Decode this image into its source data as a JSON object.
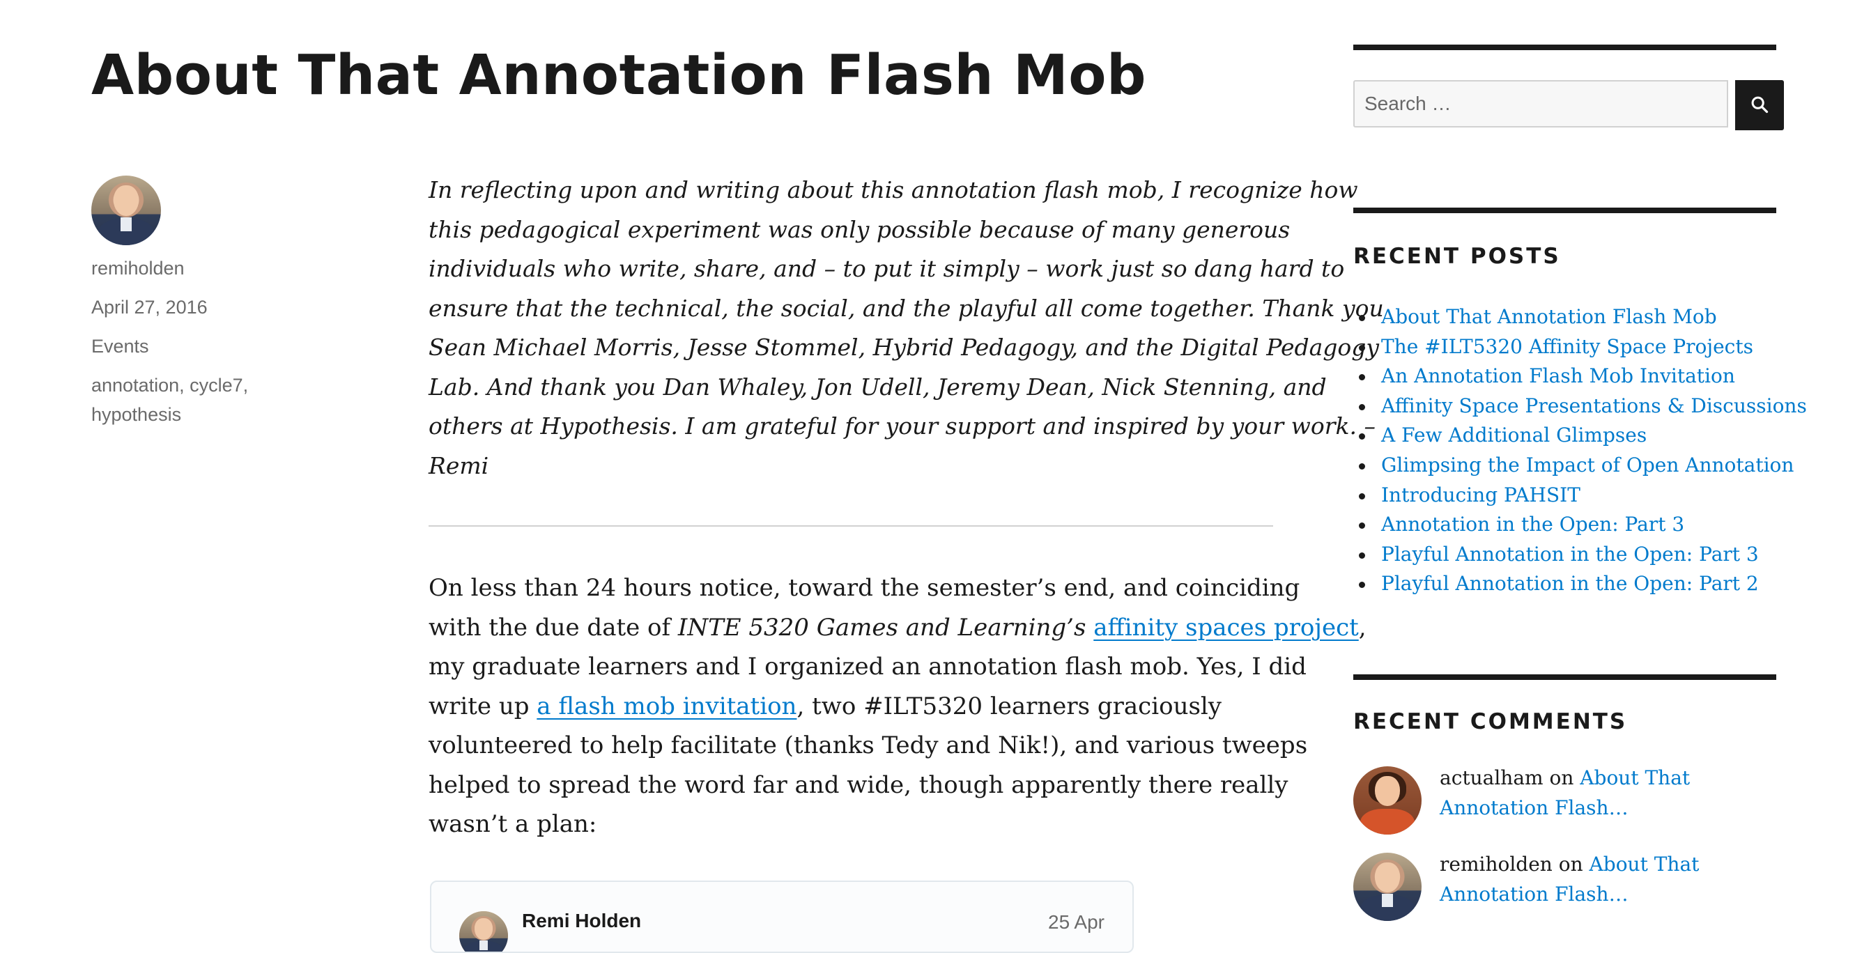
{
  "post": {
    "title": "About That Annotation Flash Mob",
    "author": "remiholden",
    "date": "April 27, 2016",
    "category": "Events",
    "tags": [
      "annotation",
      "cycle7",
      "hypothesis"
    ],
    "quote_lines": [
      "In reflecting upon and writing about this annotation flash mob, I recognize how",
      "this pedagogical experiment was only possible because of many generous",
      "individuals who write, share, and – to put it simply – work just so dang hard to",
      "ensure that the technical, the social, and the playful all come together. Thank you",
      "Sean Michael Morris, Jesse Stommel, Hybrid Pedagogy, and the Digital Pedagogy",
      "Lab. And thank you Dan Whaley, Jon Udell, Jeremy Dean, Nick Stenning, and",
      "others at Hypothesis. I am grateful for your support and inspired by your work.  –",
      "Remi"
    ],
    "body": {
      "l1": "On less than 24 hours notice, toward the semester’s end, and coinciding",
      "l2_pre": "with the due date of ",
      "l2_italic": "INTE 5320 Games and Learning’s",
      "l2_space": " ",
      "l2_link": "affinity spaces project",
      "l2_post": ",",
      "l3": "my graduate learners and I organized an annotation flash mob. Yes, I did",
      "l4_pre": "write up ",
      "l4_link": "a flash mob invitation",
      "l4_post": ", two #ILT5320 learners graciously",
      "l5": "volunteered to help facilitate (thanks Tedy and Nik!), and various tweeps",
      "l6": "helped to spread the word far and wide, though apparently there really",
      "l7": "wasn’t a plan:"
    },
    "tweet": {
      "name": "Remi Holden",
      "date": "25 Apr"
    }
  },
  "sidebar": {
    "search": {
      "placeholder": "Search …",
      "button_icon": "search-icon"
    },
    "recent_posts": {
      "title": "RECENT POSTS",
      "items": [
        "About That Annotation Flash Mob",
        "The #ILT5320 Affinity Space Projects",
        "An Annotation Flash Mob Invitation",
        "Affinity Space Presentations & Discussions",
        "A Few Additional Glimpses",
        "Glimpsing the Impact of Open Annotation",
        "Introducing PAHSIT",
        "Annotation in the Open: Part 3",
        "Playful Annotation in the Open: Part 3",
        "Playful Annotation in the Open: Part 2"
      ]
    },
    "recent_comments": {
      "title": "RECENT COMMENTS",
      "items": [
        {
          "author": "actualham",
          "on": " on ",
          "post": "About That Annotation Flash…"
        },
        {
          "author": "remiholden",
          "on": " on ",
          "post": "About That Annotation Flash…"
        }
      ]
    }
  },
  "colors": {
    "link": "#007acc",
    "text": "#1a1a1a",
    "meta": "#6a6a6a",
    "rule": "#d1d1d1"
  }
}
